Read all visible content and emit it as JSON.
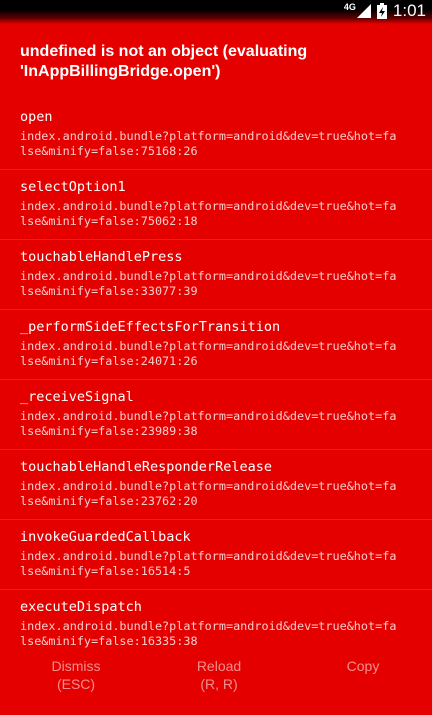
{
  "status_bar": {
    "network": "4G",
    "time": "1:01"
  },
  "error_title": "undefined is not an object (evaluating 'InAppBillingBridge.open')",
  "frames": [
    {
      "function": "open",
      "location_line1": "index.android.bundle?platform=android&dev=true&hot=fa",
      "location_line2": "lse&minify=false:75168:26"
    },
    {
      "function": "selectOption1",
      "location_line1": "index.android.bundle?platform=android&dev=true&hot=fa",
      "location_line2": "lse&minify=false:75062:18"
    },
    {
      "function": "touchableHandlePress",
      "location_line1": "index.android.bundle?platform=android&dev=true&hot=fa",
      "location_line2": "lse&minify=false:33077:39"
    },
    {
      "function": "_performSideEffectsForTransition",
      "location_line1": "index.android.bundle?platform=android&dev=true&hot=fa",
      "location_line2": "lse&minify=false:24071:26"
    },
    {
      "function": "_receiveSignal",
      "location_line1": "index.android.bundle?platform=android&dev=true&hot=fa",
      "location_line2": "lse&minify=false:23989:38"
    },
    {
      "function": "touchableHandleResponderRelease",
      "location_line1": "index.android.bundle?platform=android&dev=true&hot=fa",
      "location_line2": "lse&minify=false:23762:20"
    },
    {
      "function": "invokeGuardedCallback",
      "location_line1": "index.android.bundle?platform=android&dev=true&hot=fa",
      "location_line2": "lse&minify=false:16514:5"
    },
    {
      "function": "executeDispatch",
      "location_line1": "index.android.bundle?platform=android&dev=true&hot=fa",
      "location_line2": "lse&minify=false:16335:38"
    }
  ],
  "footer": {
    "dismiss": {
      "label": "Dismiss",
      "hint": "(ESC)"
    },
    "reload": {
      "label": "Reload",
      "hint": "(R, R)"
    },
    "copy": {
      "label": "Copy"
    }
  },
  "colors": {
    "background": "#e50000",
    "text": "#ffffff"
  },
  "icons": {
    "signal": "cellular-signal-icon",
    "battery": "battery-charging-icon"
  }
}
